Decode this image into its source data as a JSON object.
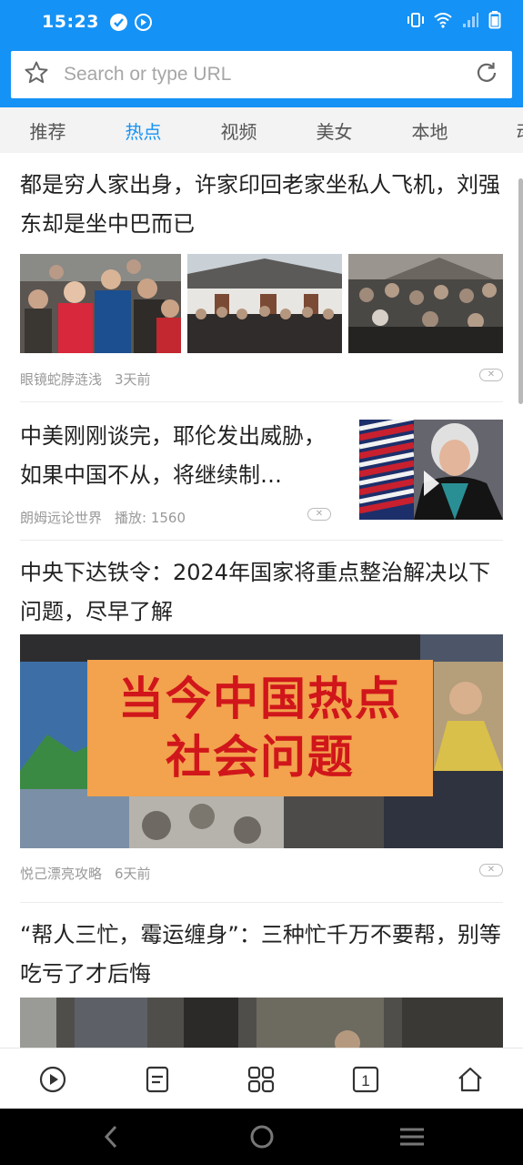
{
  "status_bar": {
    "time": "15:23",
    "left_icons": [
      "check-circle-icon",
      "play-circle-icon"
    ],
    "right_icons": [
      "vibrate-icon",
      "wifi-icon",
      "signal-icon",
      "battery-icon"
    ]
  },
  "url_bar": {
    "placeholder": "Search or type URL",
    "left_icon": "star-icon",
    "right_icon": "refresh-icon"
  },
  "tabs": [
    {
      "label": "推荐",
      "active": false
    },
    {
      "label": "热点",
      "active": true
    },
    {
      "label": "视频",
      "active": false
    },
    {
      "label": "美女",
      "active": false
    },
    {
      "label": "本地",
      "active": false
    },
    {
      "label": "动",
      "active": false
    }
  ],
  "articles": [
    {
      "title": "都是穷人家出身，许家印回老家坐私人飞机，刘强东却是坐中巴而已",
      "source": "眼镜蛇脖涟浅",
      "time": "3天前"
    },
    {
      "title": "中美刚刚谈完，耶伦发出威胁，如果中国不从，将继续制…",
      "source": "朗姆远论世界",
      "plays": "播放: 1560"
    },
    {
      "title": "中央下达铁令：2024年国家将重点整治解决以下问题，尽早了解",
      "banner_line1": "当今中国热点",
      "banner_line2": "社会问题",
      "source": "悦己漂亮攻略",
      "time": "6天前"
    },
    {
      "title": "“帮人三忙，霉运缠身”：三种忙千万不要帮，别等吃亏了才后悔"
    }
  ],
  "bottom_toolbar": [
    "video-play-icon",
    "reader-icon",
    "apps-grid-icon",
    "tabs-count-icon",
    "home-icon"
  ],
  "tab_count": "1",
  "system_nav": [
    "back-icon",
    "home-circle-icon",
    "menu-icon"
  ],
  "colors": {
    "accent": "#1592f5",
    "tab_bg": "#f3f3f3",
    "meta_text": "#999999"
  }
}
